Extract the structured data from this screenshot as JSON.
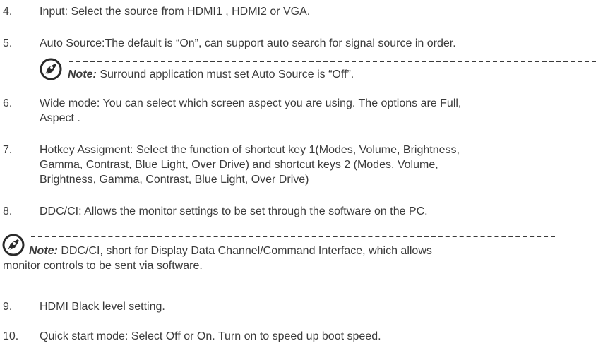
{
  "items": [
    {
      "number": "4.",
      "text": "Input: Select the source from HDMI1 , HDMI2 or VGA."
    },
    {
      "number": "5.",
      "text": "Auto Source:The default is “On”, can support auto search for signal source in order."
    },
    {
      "number": "6.",
      "line1": "Wide mode: You can select which screen aspect you are using. The options are Full,",
      "line2": "Aspect ."
    },
    {
      "number": "7.",
      "line1": "Hotkey Assigment: Select the function of shortcut key 1(Modes, Volume, Brightness,",
      "line2": "Gamma, Contrast, Blue Light, Over Drive) and shortcut keys 2 (Modes, Volume,",
      "line3": "Brightness, Gamma, Contrast, Blue Light, Over Drive)"
    },
    {
      "number": "8.",
      "text": "DDC/CI: Allows the monitor settings to be set through the software on the PC."
    },
    {
      "number": "9.",
      "text": "HDMI Black level setting."
    },
    {
      "number": "10.",
      "text": "Quick start mode: Select Off or On. Turn on to speed up boot speed."
    }
  ],
  "notes": [
    {
      "label": "Note:",
      "text": " Surround application must set Auto Source is “Off”."
    },
    {
      "label": "Note:",
      "text": " DDC/CI, short for Display Data Channel/Command Interface, which allows",
      "line2": "monitor controls to be sent via software."
    }
  ],
  "icon": "note-pen-icon"
}
